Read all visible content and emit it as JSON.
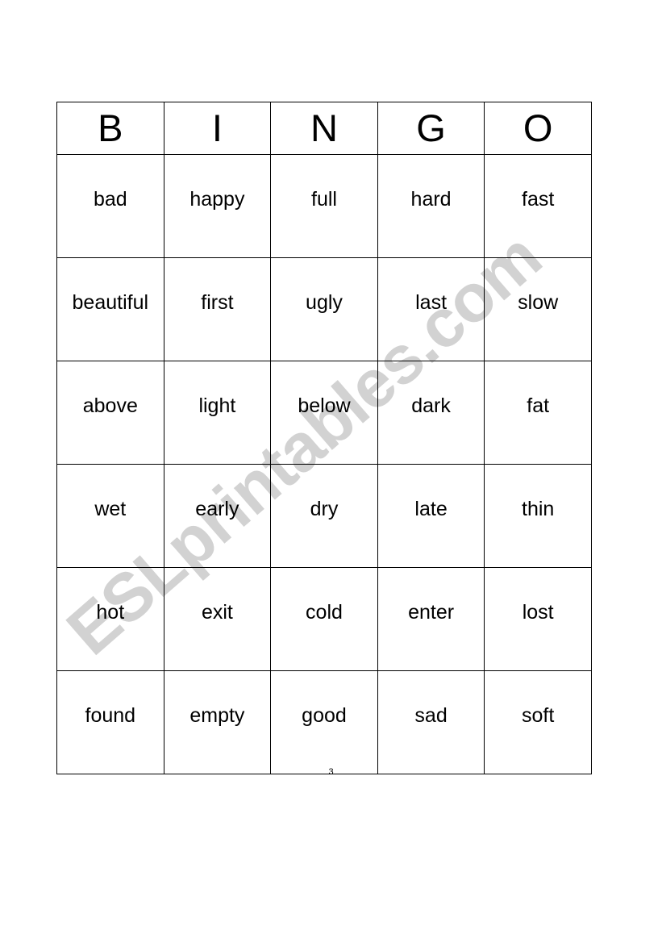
{
  "document": {
    "page_number": "3",
    "watermark_text": "ESLprintables.com",
    "watermark_color": "#d2d2d2",
    "border_color": "#000000",
    "background_color": "#ffffff",
    "text_color": "#000000"
  },
  "bingo_card": {
    "headers": [
      "B",
      "I",
      "N",
      "G",
      "O"
    ],
    "rows": [
      [
        "bad",
        "happy",
        "full",
        "hard",
        "fast"
      ],
      [
        "beautiful",
        "first",
        "ugly",
        "last",
        "slow"
      ],
      [
        "above",
        "light",
        "below",
        "dark",
        "fat"
      ],
      [
        "wet",
        "early",
        "dry",
        "late",
        "thin"
      ],
      [
        "hot",
        "exit",
        "cold",
        "enter",
        "lost"
      ],
      [
        "found",
        "empty",
        "good",
        "sad",
        "soft"
      ]
    ]
  }
}
